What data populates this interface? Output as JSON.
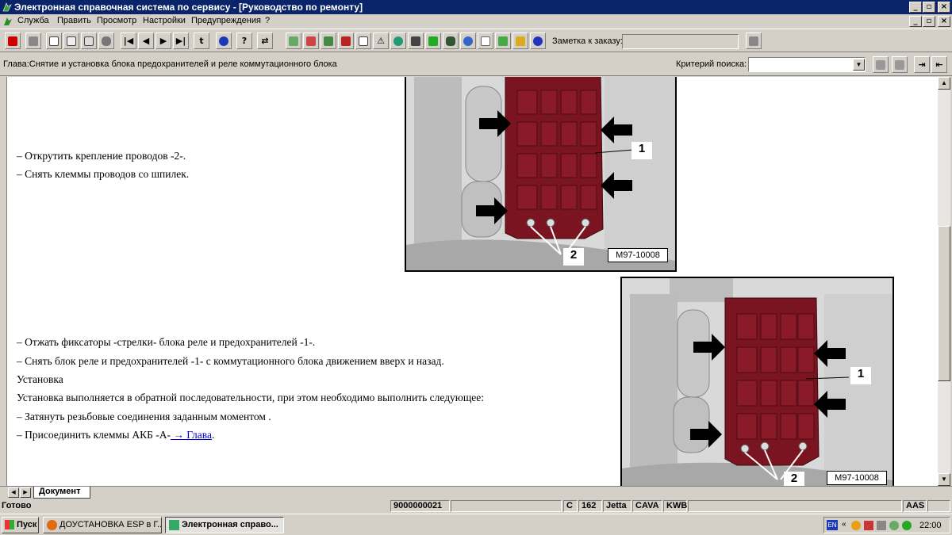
{
  "window": {
    "title": "Электронная справочная система по сервису - [Руководство по ремонту]",
    "controls": [
      "_",
      "▫",
      "×"
    ]
  },
  "menu": {
    "items": [
      "Служба",
      "Править",
      "Просмотр",
      "Настройки",
      "Предупреждения",
      "?"
    ]
  },
  "toolbar": {
    "note_label": "Заметка к заказу:",
    "note_value": ""
  },
  "chapter": {
    "text": "Глава:Снятие и установка блока предохранителей и реле коммутационного блока",
    "search_label": "Критерий  поиска:",
    "search_value": ""
  },
  "document": {
    "lines": [
      "–  Открутить крепление проводов -2-.",
      "–  Снять клеммы проводов со шпилек.",
      "–  Отжать фиксаторы -стрелки- блока реле и предохранителей -1-.",
      "–  Снять блок реле и предохранителей -1- с коммутационного блока движением вверх и назад.",
      "Установка",
      "Установка выполняется в обратной последовательности, при этом необходимо выполнить следующее:",
      "–  Затянуть резьбовые соединения заданным моментом ."
    ],
    "last_line_prefix": "–  Присоединить клеммы АКБ -А-",
    "last_line_link": " → Глава",
    "last_line_suffix": ".",
    "figures": [
      {
        "callout_1": "1",
        "callout_2": "2",
        "code": "M97-10008"
      },
      {
        "callout_1": "1",
        "callout_2": "2",
        "code": "M97-10008"
      }
    ]
  },
  "tabs": {
    "active": "Документ"
  },
  "status": {
    "ready": "Готово",
    "order": "9000000021",
    "c": "C",
    "num": "162",
    "model": "Jetta",
    "engine": "CAVA",
    "code": "KWB",
    "aas": "AAS"
  },
  "taskbar": {
    "start": "Пуск",
    "tasks": [
      "ДОУСТАНОВКА ESP в Г...",
      "Электронная справо..."
    ],
    "lang": "EN",
    "clock": "22:00"
  },
  "colors": {
    "titlebar": "#0a246a",
    "relay_block": "#7a1420",
    "link": "#0000cc"
  }
}
